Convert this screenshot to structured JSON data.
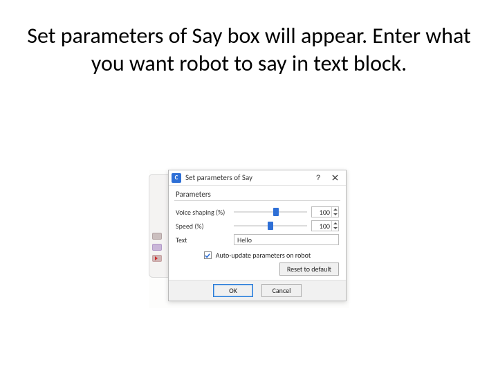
{
  "slide": {
    "title": "Set parameters of Say box will appear.  Enter what you want robot to say in text block."
  },
  "dialog": {
    "title": "Set parameters of Say",
    "section_label": "Parameters",
    "voice_shaping_label": "Voice shaping (%)",
    "voice_shaping_value": "100",
    "speed_label": "Speed (%)",
    "speed_value": "100",
    "text_label": "Text",
    "text_value": "Hello",
    "auto_update_label": "Auto-update parameters on robot",
    "reset_label": "Reset to default",
    "ok_label": "OK",
    "cancel_label": "Cancel"
  }
}
